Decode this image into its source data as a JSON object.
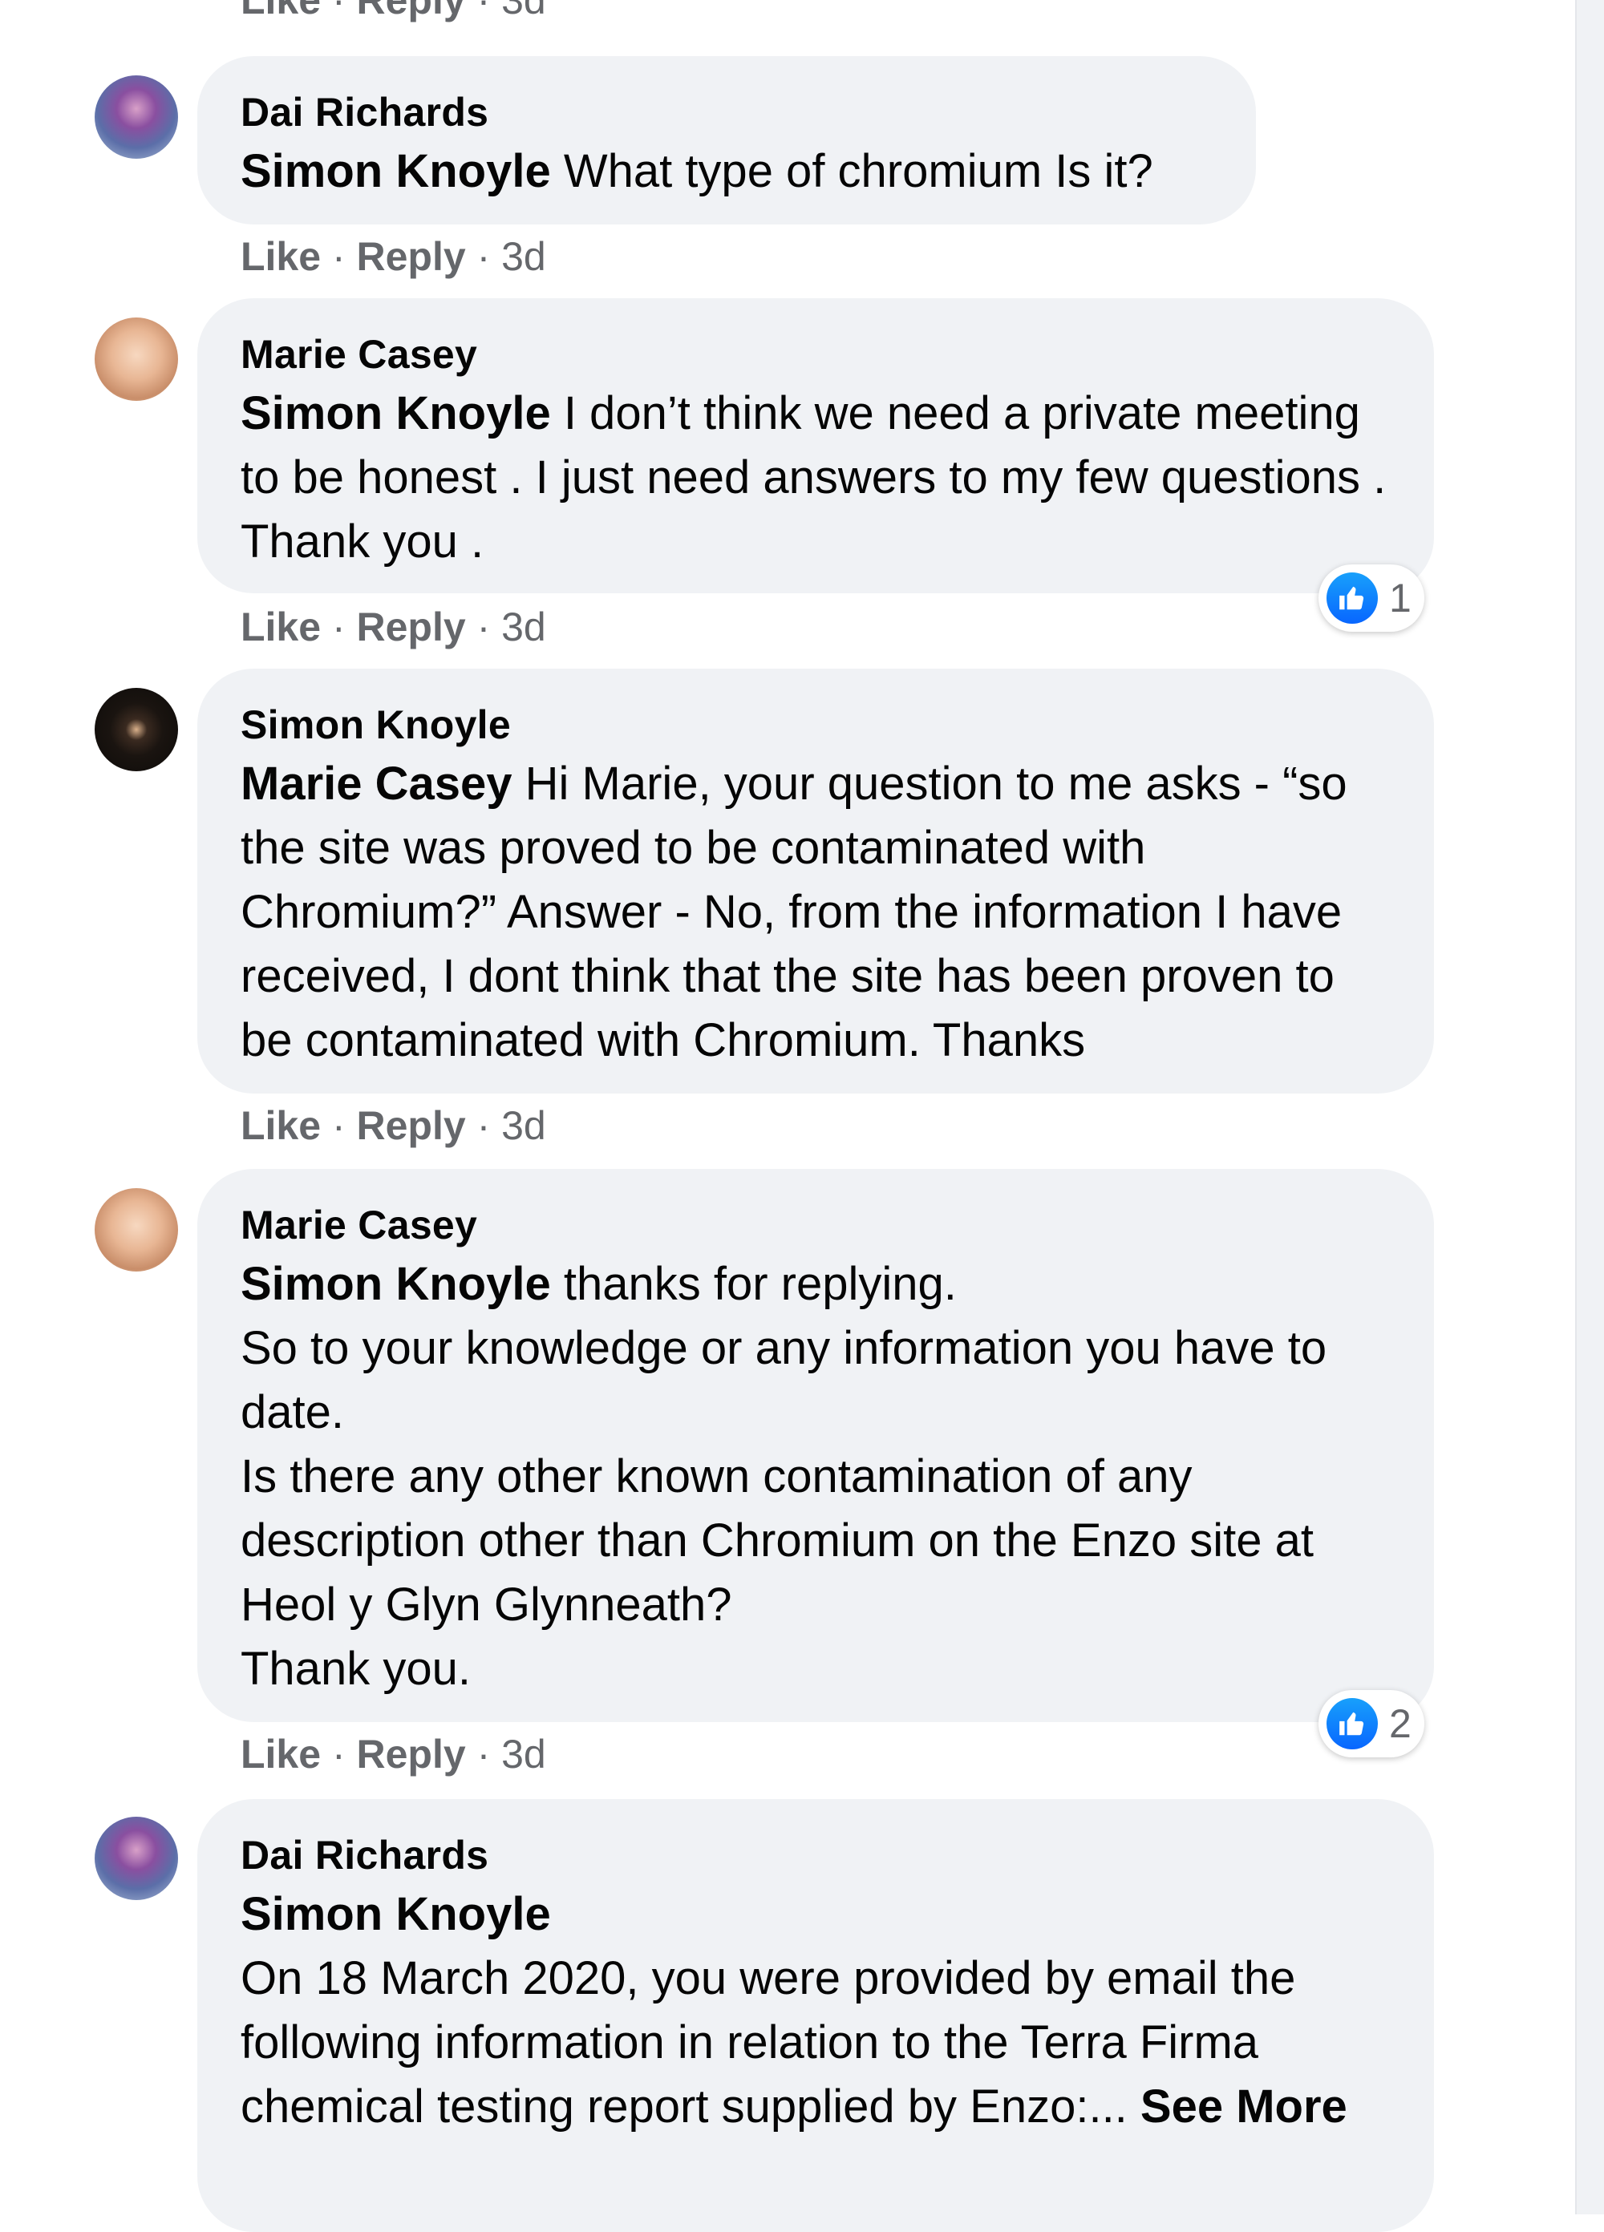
{
  "top_actions": {
    "like": "Like",
    "reply": "Reply",
    "time": "3d"
  },
  "comments": [
    {
      "author": "Dai Richards",
      "mention": "Simon Knoyle",
      "text": " What type of chromium Is it?",
      "actions": {
        "like": "Like",
        "reply": "Reply",
        "time": "3d"
      }
    },
    {
      "author": "Marie Casey",
      "mention": "Simon Knoyle",
      "text": " I don’t think we need a private meeting to be honest . I just need answers to my few questions . Thank you .",
      "reaction_count": "1",
      "actions": {
        "like": "Like",
        "reply": "Reply",
        "time": "3d"
      }
    },
    {
      "author": "Simon Knoyle",
      "mention": "Marie Casey",
      "text": " Hi Marie, your question to me asks - “so the site was proved to be contaminated with Chromium?” Answer - No, from the information I have received, I dont think that the site has been proven to be contaminated with Chromium. Thanks",
      "actions": {
        "like": "Like",
        "reply": "Reply",
        "time": "3d"
      }
    },
    {
      "author": "Marie Casey",
      "mention": "Simon Knoyle",
      "text": " thanks for replying.\nSo to your knowledge or any information you have to date.\nIs there any other known contamination of any description other than Chromium on the Enzo site at Heol y Glyn Glynneath?\nThank you.",
      "reaction_count": "2",
      "actions": {
        "like": "Like",
        "reply": "Reply",
        "time": "3d"
      }
    },
    {
      "author": "Dai Richards",
      "mention": "Simon Knoyle",
      "text": "On 18 March 2020, you were provided by email the following information in relation to the Terra Firma chemical testing report supplied by Enzo:... ",
      "see_more": "See More"
    }
  ],
  "icons": {
    "avatar_dai": "avatar",
    "avatar_marie": "avatar",
    "avatar_simon": "avatar",
    "like_reaction": "thumbs-up-icon"
  },
  "colors": {
    "bubble": "#f0f2f5",
    "like_blue": "#0866ff",
    "secondary_text": "#65676b"
  }
}
